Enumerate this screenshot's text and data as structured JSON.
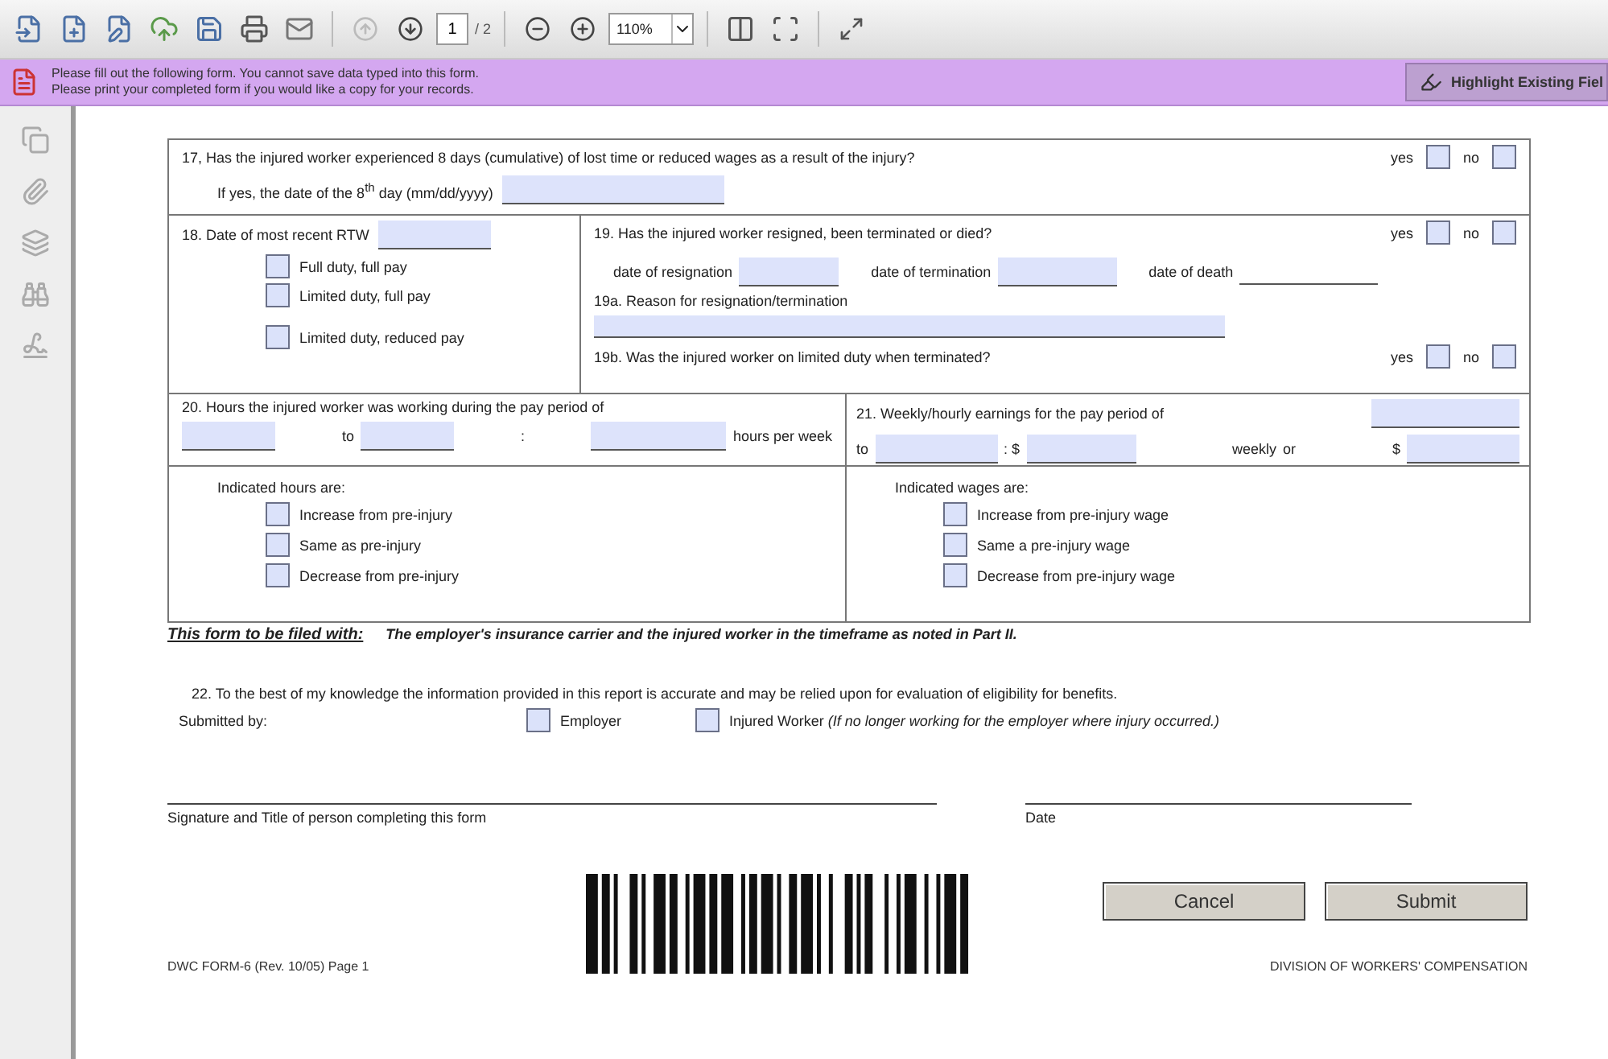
{
  "toolbar": {
    "page": "1",
    "page_total": "/ 2",
    "zoom": "110%"
  },
  "notice": {
    "lines": [
      "Please fill out the following form. You cannot save data typed into this form.",
      "Please print your completed form if you would like a copy for your records."
    ],
    "button": "Highlight Existing Fiel"
  },
  "q17": {
    "question": "17, Has the injured worker experienced 8 days (cumulative) of lost time or reduced wages as a result of the injury?",
    "followup": "If yes, the date of the 8$^{th}$ day (mm/dd/yyyy)",
    "options": [
      {
        "label": "yes",
        "checked": false
      },
      {
        "label": "no",
        "checked": false
      }
    ]
  },
  "q18": {
    "label": "18.  Date of most recent RTW",
    "options": [
      {
        "label": "Full duty, full pay",
        "checked": false
      },
      {
        "label": "Limited duty, full pay",
        "checked": false
      },
      {
        "label": "Limited duty, reduced pay",
        "checked": false
      }
    ]
  },
  "q19": {
    "question": "19.  Has the injured worker resigned, been terminated or died?",
    "options": [
      {
        "label": "yes",
        "checked": false
      },
      {
        "label": "no",
        "checked": false
      }
    ],
    "dates": [
      {
        "label": "date of resignation",
        "kind": "field"
      },
      {
        "label": "date of termination",
        "kind": "field"
      },
      {
        "label": "date of death",
        "kind": "line"
      }
    ],
    "reason": "19a. Reason for resignation/termination",
    "limited": "19b. Was the injured worker on limited duty when terminated?",
    "limited_options": [
      {
        "label": "yes",
        "checked": false
      },
      {
        "label": "no",
        "checked": false
      }
    ]
  },
  "q20": {
    "question": "20.  Hours the injured worker was working during the pay period of",
    "to": "to",
    "colon": ":",
    "unit": "hours per week",
    "indicated": "Indicated hours are:",
    "options": [
      {
        "label": "Increase from pre-injury",
        "checked": false
      },
      {
        "label": "Same as pre-injury",
        "checked": false
      },
      {
        "label": "Decrease from pre-injury",
        "checked": false
      }
    ]
  },
  "q21": {
    "question": "21.  Weekly/hourly earnings for the pay period of",
    "to": "to",
    "dollar": ": $",
    "weekly": "weekly",
    "or": "or",
    "dollar2": "$",
    "indicated": "Indicated wages are:",
    "options": [
      {
        "label": "Increase from pre-injury wage",
        "checked": false
      },
      {
        "label": "Same a pre-injury wage",
        "checked": false
      },
      {
        "label": "Decrease from pre-injury wage",
        "checked": false
      }
    ]
  },
  "filing": {
    "label": "This form to be filed with:",
    "text": "The employer's insurance carrier and the injured worker in the timeframe as noted in Part II."
  },
  "q22": {
    "text": "22.  To the best of my knowledge the information provided in this report is accurate and may be relied  upon for evaluation of eligibility for benefits.",
    "submitted_by": "Submitted by:",
    "options": [
      {
        "label": "Employer",
        "checked": false
      },
      {
        "label": "Injured Worker *(If no longer working for the employer where injury occurred.)*",
        "checked": false
      }
    ]
  },
  "signatures": [
    "Signature and Title of person completing this form",
    "Date"
  ],
  "buttons": [
    "Cancel",
    "Submit"
  ],
  "footer": {
    "form_id": "DWC FORM-6 (Rev. 10/05) Page 1",
    "division": "DIVISION OF WORKERS' COMPENSATION"
  }
}
